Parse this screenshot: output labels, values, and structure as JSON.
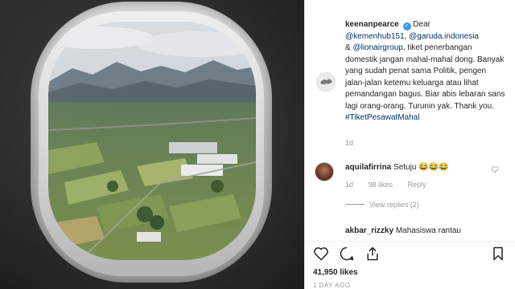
{
  "post": {
    "author": "keenanpearce",
    "caption_lead": "Dear",
    "mention_1": "@kemenhub151",
    "mention_2": "@garuda.indonesia",
    "mention_3": "@lionairgroup",
    "caption_sep_1": ",",
    "caption_amp": "&",
    "caption_body": ", tiket penerbangan domestik jangan mahal-mahal dong. Banyak yang sudah penat sama Politik, pengen jalan-jalan ketemu keluarga atau lihat pemandangan bagus. Biar abis lebaran sans lagi orang-orang. Turunin yak. Thank you.",
    "hashtag": "#TiketPesawatMahal",
    "time": "1d"
  },
  "comments": [
    {
      "author": "aquilafirrina",
      "text": "Setuju 😂😂😂",
      "time": "1d",
      "likes": "98 likes",
      "reply": "Reply",
      "view_replies": "View replies (2)"
    },
    {
      "author": "akbar_rizzky",
      "text": "Mahasiswa rantau"
    }
  ],
  "footer": {
    "likes": "41,950 likes",
    "ago": "1 DAY AGO"
  },
  "icons": {
    "heart": "heart-icon",
    "comment": "comment-icon",
    "share": "share-icon",
    "save": "bookmark-icon",
    "verified": "verified-badge-icon"
  },
  "colors": {
    "link": "#003569",
    "verified": "#3897f0",
    "muted": "#999999"
  }
}
